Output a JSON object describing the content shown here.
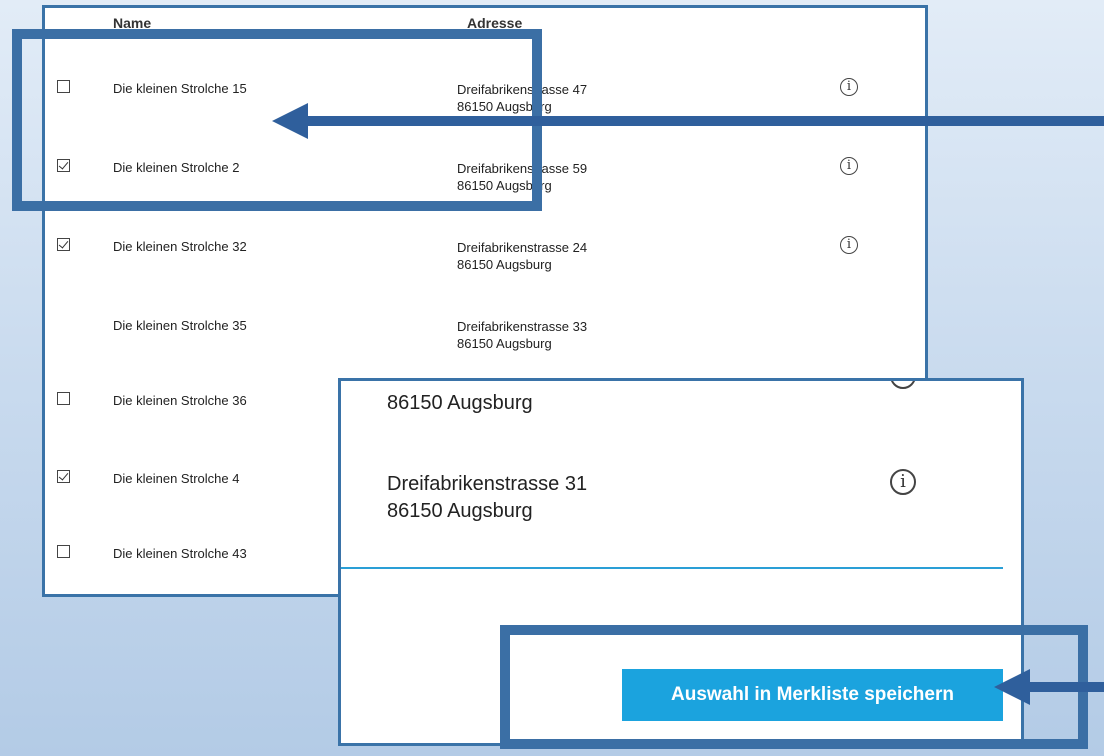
{
  "table": {
    "headers": {
      "name": "Name",
      "address": "Adresse"
    },
    "rows": [
      {
        "checkbox": "unchecked",
        "name": "Die kleinen Strolche 15",
        "street": "Dreifabrikenstrasse 47",
        "city": "86150 Augsburg",
        "info": "i"
      },
      {
        "checkbox": "checked",
        "name": "Die kleinen Strolche 2",
        "street": "Dreifabrikenstrasse 59",
        "city": "86150 Augsburg",
        "info": "i"
      },
      {
        "checkbox": "checked",
        "name": "Die kleinen Strolche 32",
        "street": "Dreifabrikenstrasse 24",
        "city": "86150 Augsburg",
        "info": "i"
      },
      {
        "checkbox": "none",
        "name": "Die kleinen Strolche 35",
        "street": "Dreifabrikenstrasse 33",
        "city": "86150 Augsburg"
      },
      {
        "checkbox": "unchecked",
        "name": "Die kleinen Strolche 36"
      },
      {
        "checkbox": "checked",
        "name": "Die kleinen Strolche 4"
      },
      {
        "checkbox": "unchecked",
        "name": "Die kleinen Strolche 43"
      }
    ]
  },
  "zoom": {
    "top_city": "86150 Augsburg",
    "street": "Dreifabrikenstrasse 31",
    "city": "86150 Augsburg",
    "info": "i",
    "save_label": "Auswahl in Merkliste speichern"
  },
  "colors": {
    "highlight": "#3b6fa5",
    "arrow": "#2f5f9c",
    "button": "#1ba3de",
    "divider": "#2a9fd6"
  }
}
